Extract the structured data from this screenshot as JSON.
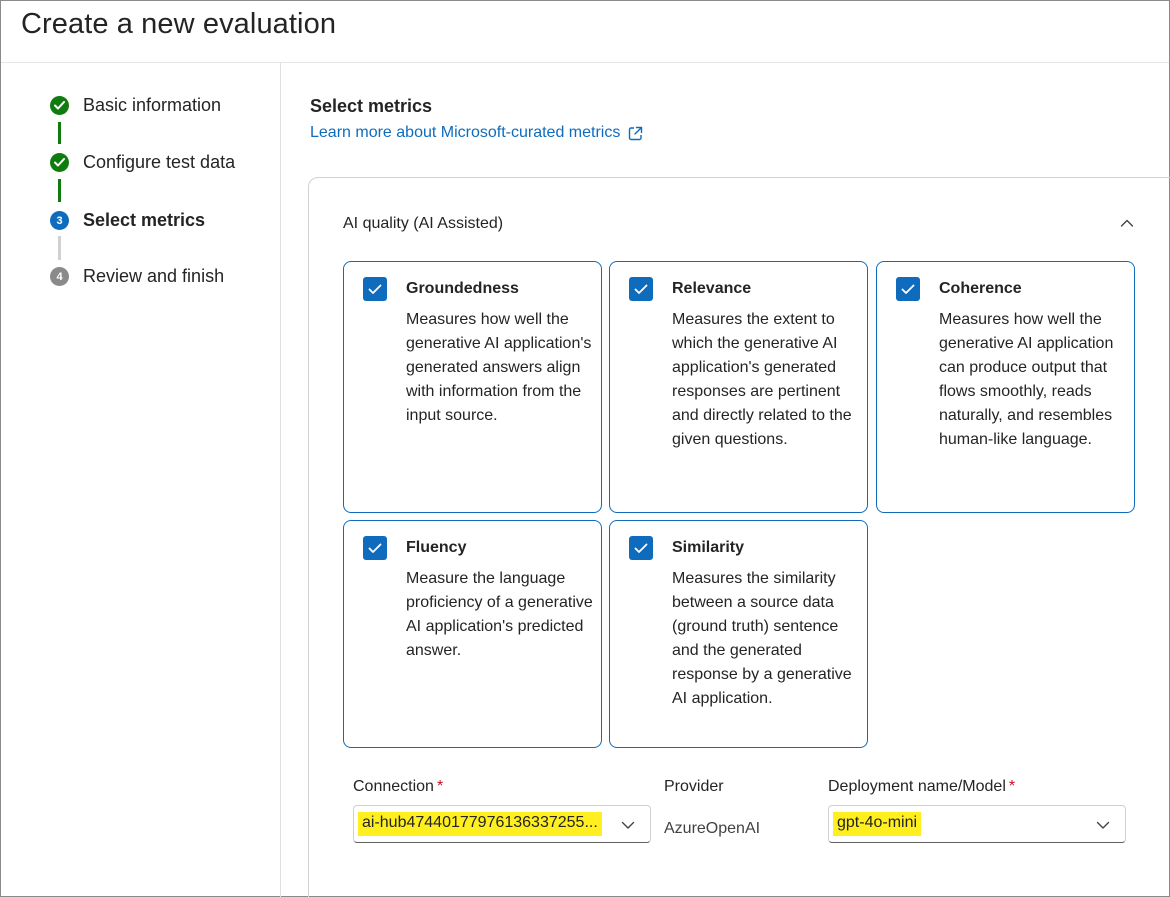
{
  "page": {
    "title": "Create a new evaluation"
  },
  "stepper": {
    "steps": [
      {
        "label": "Basic information",
        "status": "complete",
        "marker": ""
      },
      {
        "label": "Configure test data",
        "status": "complete",
        "marker": ""
      },
      {
        "label": "Select metrics",
        "status": "current",
        "marker": "3"
      },
      {
        "label": "Review and finish",
        "status": "pending",
        "marker": "4"
      }
    ]
  },
  "main": {
    "section_title": "Select metrics",
    "learn_more_link": "Learn more about Microsoft-curated metrics",
    "panel": {
      "heading": "AI quality (AI Assisted)",
      "expanded": true,
      "metrics": [
        {
          "name": "Groundedness",
          "checked": true,
          "description": "Measures how well the generative AI application's generated answers align with information from the input source."
        },
        {
          "name": "Relevance",
          "checked": true,
          "description": "Measures the extent to which the generative AI application's generated responses are pertinent and directly related to the given questions."
        },
        {
          "name": "Coherence",
          "checked": true,
          "description": "Measures how well the generative AI application can produce output that flows smoothly, reads naturally, and resembles human-like language."
        },
        {
          "name": "Fluency",
          "checked": true,
          "description": "Measure the language proficiency of a generative AI application's predicted answer."
        },
        {
          "name": "Similarity",
          "checked": true,
          "description": "Measures the similarity between a source data (ground truth) sentence and the generated response by a generative AI application."
        }
      ]
    },
    "form": {
      "connection": {
        "label": "Connection",
        "required_mark": "*",
        "value": "ai-hub47440177976136337255..."
      },
      "provider": {
        "label": "Provider",
        "value": "AzureOpenAI"
      },
      "deployment": {
        "label": "Deployment name/Model",
        "required_mark": "*",
        "value": "gpt-4o-mini"
      }
    }
  },
  "colors": {
    "accent": "#0f6cbd",
    "success": "#107c10",
    "highlight": "#ffef1f",
    "required": "#c50f1f"
  }
}
